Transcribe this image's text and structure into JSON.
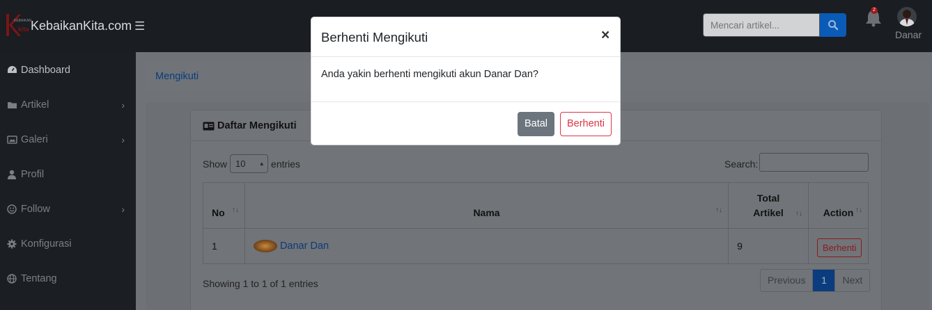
{
  "navbar": {
    "brand_text": "KebaikanKita.com",
    "logo_small_text": "KEBAIKAN",
    "search_placeholder": "Mencari artikel...",
    "notification_count": "2",
    "user_name": "Danar"
  },
  "sidebar": {
    "items": [
      {
        "label": "Dashboard",
        "icon": "dashboard-icon",
        "has_submenu": false
      },
      {
        "label": "Artikel",
        "icon": "folder-icon",
        "has_submenu": true
      },
      {
        "label": "Galeri",
        "icon": "images-icon",
        "has_submenu": true
      },
      {
        "label": "Profil",
        "icon": "user-icon",
        "has_submenu": false
      },
      {
        "label": "Follow",
        "icon": "smile-icon",
        "has_submenu": true
      },
      {
        "label": "Konfigurasi",
        "icon": "gear-icon",
        "has_submenu": false
      },
      {
        "label": "Tentang",
        "icon": "globe-icon",
        "has_submenu": false
      }
    ]
  },
  "breadcrumb": {
    "current": "Mengikuti"
  },
  "card": {
    "title": "Daftar Mengikuti",
    "show_label": "Show",
    "entries_value": "10",
    "entries_label": "entries",
    "search_label": "Search:",
    "table": {
      "headers": [
        "No",
        "Nama",
        "Total Artikel",
        "Action"
      ],
      "rows": [
        {
          "no": "1",
          "nama": "Danar Dan",
          "total_artikel": "9",
          "action": "Berhenti"
        }
      ]
    },
    "info": "Showing 1 to 1 of 1 entries",
    "pagination": {
      "previous": "Previous",
      "current": "1",
      "next": "Next"
    }
  },
  "modal": {
    "title": "Berhenti Mengikuti",
    "close_symbol": "×",
    "message": "Anda yakin berhenti mengikuti akun Danar Dan?",
    "cancel_label": "Batal",
    "confirm_label": "Berhenti"
  },
  "colors": {
    "primary": "#0a5ab8",
    "danger": "#dc3545",
    "secondary": "#6c757d"
  }
}
